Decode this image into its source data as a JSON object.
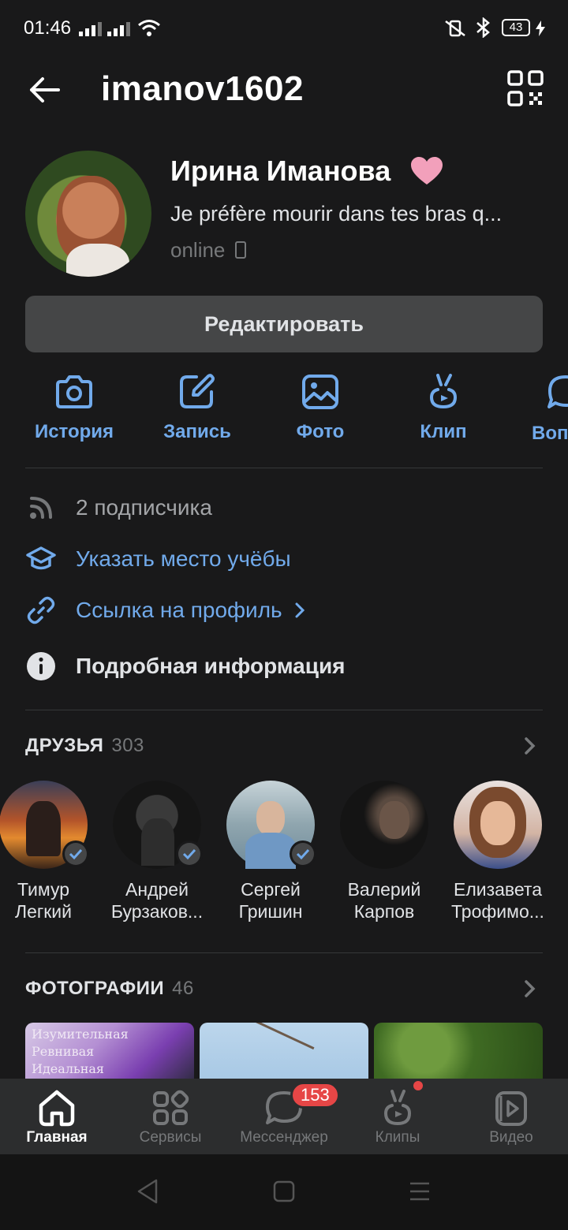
{
  "status_bar": {
    "time": "01:46",
    "battery": "43"
  },
  "header": {
    "username": "imanov1602"
  },
  "profile": {
    "name": "Ирина Иманова",
    "status_text": "Je préfère mourir dans tes bras q...",
    "online": "online"
  },
  "edit_button": "Редактировать",
  "actions": [
    {
      "label": "История"
    },
    {
      "label": "Запись"
    },
    {
      "label": "Фото"
    },
    {
      "label": "Клип"
    },
    {
      "label": "Вопрос"
    }
  ],
  "info": {
    "followers": "2 подписчика",
    "education": "Указать место учёбы",
    "profile_link": "Ссылка на профиль",
    "details": "Подробная информация"
  },
  "friends": {
    "title": "ДРУЗЬЯ",
    "count": "303",
    "items": [
      {
        "line1": "Тимур",
        "line2": "Легкий"
      },
      {
        "line1": "Андрей",
        "line2": "Бурзаков..."
      },
      {
        "line1": "Сергей",
        "line2": "Гришин"
      },
      {
        "line1": "Валерий",
        "line2": "Карпов"
      },
      {
        "line1": "Елизавета",
        "line2": "Трофимо..."
      }
    ]
  },
  "photos": {
    "title": "ФОТОГРАФИИ",
    "count": "46",
    "first_caption": [
      "Изумительная",
      "Ревнивая",
      "Идеальная"
    ]
  },
  "tabbar": {
    "items": [
      {
        "label": "Главная"
      },
      {
        "label": "Сервисы"
      },
      {
        "label": "Мессенджер"
      },
      {
        "label": "Клипы"
      },
      {
        "label": "Видео"
      }
    ],
    "messenger_badge": "153"
  },
  "colors": {
    "accent": "#71aaeb",
    "background": "#19191a",
    "badge": "#e64646"
  }
}
